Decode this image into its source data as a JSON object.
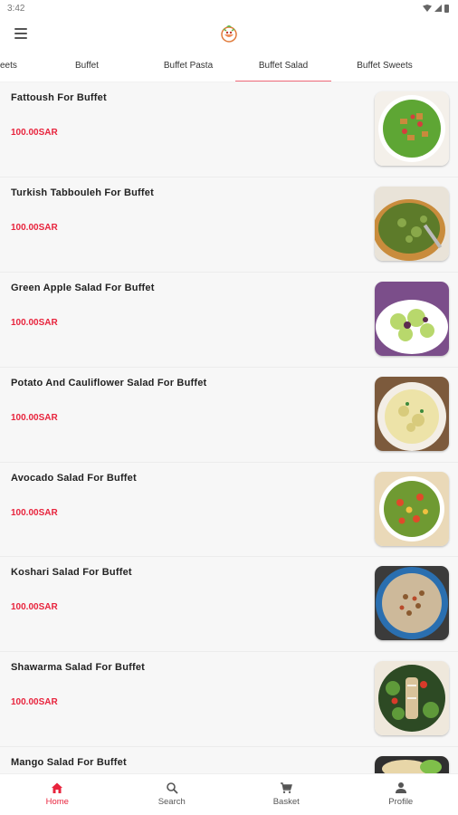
{
  "status": {
    "time": "3:42"
  },
  "tabs": [
    {
      "label": "eets",
      "active": false
    },
    {
      "label": "Buffet",
      "active": false
    },
    {
      "label": "Buffet Pasta",
      "active": false
    },
    {
      "label": "Buffet Salad",
      "active": true
    },
    {
      "label": "Buffet Sweets",
      "active": false
    }
  ],
  "products": [
    {
      "name": "Fattoush For Buffet",
      "price": "100.00SAR",
      "image": "fattoush-salad-photo"
    },
    {
      "name": "Turkish Tabbouleh For Buffet",
      "price": "100.00SAR",
      "image": "tabbouleh-photo"
    },
    {
      "name": "Green Apple Salad For Buffet",
      "price": "100.00SAR",
      "image": "green-apple-salad-photo"
    },
    {
      "name": "Potato And Cauliflower Salad For Buffet",
      "price": "100.00SAR",
      "image": "potato-salad-photo"
    },
    {
      "name": "Avocado Salad For Buffet",
      "price": "100.00SAR",
      "image": "avocado-salad-photo"
    },
    {
      "name": "Koshari Salad For Buffet",
      "price": "100.00SAR",
      "image": "koshari-salad-photo"
    },
    {
      "name": "Shawarma Salad For Buffet",
      "price": "100.00SAR",
      "image": "shawarma-salad-photo"
    },
    {
      "name": "Mango Salad For Buffet",
      "price": "",
      "image": "mango-salad-photo"
    }
  ],
  "bottom_nav": [
    {
      "label": "Home",
      "icon": "home-icon",
      "active": true
    },
    {
      "label": "Search",
      "icon": "search-icon",
      "active": false
    },
    {
      "label": "Basket",
      "icon": "cart-icon",
      "active": false
    },
    {
      "label": "Profile",
      "icon": "profile-icon",
      "active": false
    }
  ],
  "colors": {
    "accent": "#e8243d",
    "tab_indicator": "#f06a7a",
    "list_background": "#f7f7f7"
  }
}
